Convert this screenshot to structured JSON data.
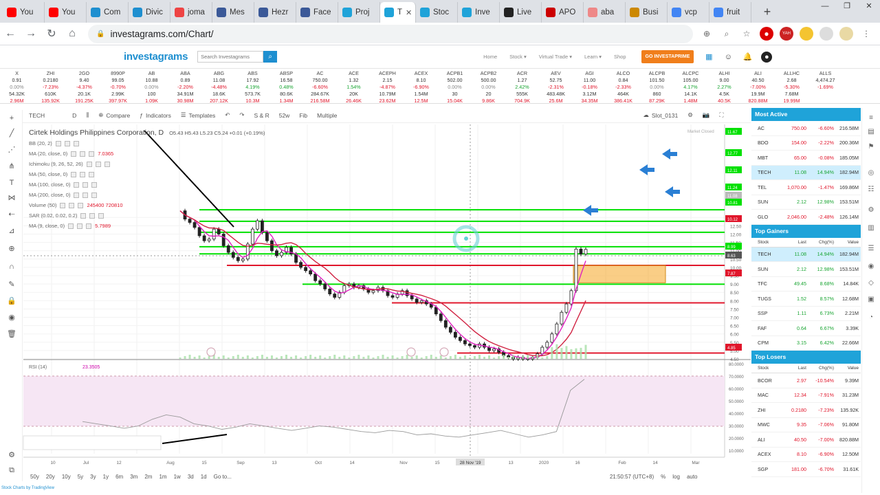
{
  "tabs": [
    {
      "label": "You",
      "fav": "#ff0000"
    },
    {
      "label": "You",
      "fav": "#ff0000"
    },
    {
      "label": "Com",
      "fav": "#1e8fd0"
    },
    {
      "label": "Divic",
      "fav": "#1e8fd0"
    },
    {
      "label": "joma",
      "fav": "#e44"
    },
    {
      "label": "Mes",
      "fav": "#3b5998"
    },
    {
      "label": "Hezr",
      "fav": "#3b5998"
    },
    {
      "label": "Face",
      "fav": "#3b5998"
    },
    {
      "label": "Proj",
      "fav": "#1fa3d9"
    },
    {
      "label": "T",
      "fav": "#1fa3d9",
      "active": true
    },
    {
      "label": "Stoc",
      "fav": "#1fa3d9"
    },
    {
      "label": "Inve",
      "fav": "#1fa3d9"
    },
    {
      "label": "Live",
      "fav": "#222"
    },
    {
      "label": "APO",
      "fav": "#c00"
    },
    {
      "label": "aba",
      "fav": "#e88"
    },
    {
      "label": "Busi",
      "fav": "#c80"
    },
    {
      "label": "vcp",
      "fav": "#4285f4"
    },
    {
      "label": "fruit",
      "fav": "#4285f4"
    }
  ],
  "address": {
    "url": "investagrams.com/Chart/"
  },
  "site": {
    "logo": "investagrams",
    "search_placeholder": "Search Investagrams",
    "nav": [
      "Home",
      "Stock ▾",
      "Virtual Trade ▾",
      "Learn ▾",
      "Shop"
    ],
    "go_button": "GO INVESTAPRIME"
  },
  "ticker": [
    {
      "s": "X",
      "l": "0.91",
      "c": "0.00%",
      "v": "2.96M",
      "d": "fl"
    },
    {
      "s": "ZHI",
      "l": "0.2180",
      "c": "-7.23%",
      "v": "135.92K",
      "d": "dn"
    },
    {
      "s": "2GO",
      "l": "9.40",
      "c": "-4.37%",
      "v": "191.25K",
      "d": "dn"
    },
    {
      "s": "8990P",
      "l": "99.05",
      "c": "-0.70%",
      "v": "397.97K",
      "d": "dn"
    },
    {
      "s": "AB",
      "l": "10.88",
      "c": "0.00%",
      "v": "1.09K",
      "d": "fl"
    },
    {
      "s": "ABA",
      "l": "0.89",
      "c": "-2.20%",
      "v": "30.98M",
      "d": "dn"
    },
    {
      "s": "ABG",
      "l": "11.08",
      "c": "-4.48%",
      "v": "207.12K",
      "d": "dn"
    },
    {
      "s": "ABS",
      "l": "17.92",
      "c": "4.19%",
      "v": "10.3M",
      "d": "up"
    },
    {
      "s": "ABSP",
      "l": "16.58",
      "c": "0.48%",
      "v": "1.34M",
      "d": "up"
    },
    {
      "s": "AC",
      "l": "750.00",
      "c": "-6.60%",
      "v": "216.58M",
      "d": "dn"
    },
    {
      "s": "ACE",
      "l": "1.32",
      "c": "1.54%",
      "v": "26.46K",
      "d": "up"
    },
    {
      "s": "ACEPH",
      "l": "2.15",
      "c": "-4.87%",
      "v": "23.62M",
      "d": "dn"
    },
    {
      "s": "ACEX",
      "l": "8.10",
      "c": "-6.90%",
      "v": "12.5M",
      "d": "dn"
    },
    {
      "s": "ACPB1",
      "l": "502.00",
      "c": "0.00%",
      "v": "15.04K",
      "d": "fl"
    },
    {
      "s": "ACPB2",
      "l": "500.00",
      "c": "0.00%",
      "v": "9.86K",
      "d": "fl"
    },
    {
      "s": "ACR",
      "l": "1.27",
      "c": "2.42%",
      "v": "704.9K",
      "d": "up"
    },
    {
      "s": "AEV",
      "l": "52.75",
      "c": "-2.31%",
      "v": "25.6M",
      "d": "dn"
    },
    {
      "s": "AGI",
      "l": "11.00",
      "c": "-0.18%",
      "v": "34.35M",
      "d": "dn"
    },
    {
      "s": "ALCO",
      "l": "0.84",
      "c": "-2.33%",
      "v": "386.41K",
      "d": "dn"
    },
    {
      "s": "ALCPB",
      "l": "101.50",
      "c": "0.00%",
      "v": "87.29K",
      "d": "fl"
    },
    {
      "s": "ALCPC",
      "l": "105.00",
      "c": "4.17%",
      "v": "1.48M",
      "d": "up"
    },
    {
      "s": "ALHI",
      "l": "9.00",
      "c": "2.27%",
      "v": "40.5K",
      "d": "up"
    },
    {
      "s": "ALI",
      "l": "40.50",
      "c": "-7.00%",
      "v": "820.88M",
      "d": "dn"
    },
    {
      "s": "ALLHC",
      "l": "2.68",
      "c": "-5.30%",
      "v": "19.99M",
      "d": "dn"
    },
    {
      "s": "ALLS",
      "l": "4,474.27",
      "c": "-1.69%",
      "v": "",
      "d": "dn"
    }
  ],
  "ticker_row3": [
    "54.32K",
    "610K",
    "20.1K",
    "2.99K",
    "100",
    "34.91M",
    "18.6K",
    "573.7K",
    "80.6K",
    "284.67K",
    "20K",
    "10.79M",
    "1.54M",
    "30",
    "20",
    "555K",
    "483.48K",
    "3.12M",
    "464K",
    "860",
    "14.1K",
    "4.5K",
    "19.9M",
    "7.68M",
    ""
  ],
  "toolbar": {
    "symbol": "TECH",
    "interval": "D",
    "compare": "Compare",
    "indicators": "Indicators",
    "templates": "Templates",
    "sr": "S & R",
    "w52": "52w",
    "fib": "Fib",
    "multiple": "Multiple",
    "slot": "Slot_0131"
  },
  "legend": {
    "title": "Cirtek Holdings Philippines Corporation, D",
    "ohlc": "O5.43  H5.43  L5.23  C5.24  +0.01 (+0.19%)",
    "rows": [
      {
        "label": "BB (20, 2)",
        "value": ""
      },
      {
        "label": "MA (20, close, 0)",
        "value": "7.0365"
      },
      {
        "label": "Ichimoku (9, 26, 52, 26)",
        "value": ""
      },
      {
        "label": "MA (50, close, 0)",
        "value": ""
      },
      {
        "label": "MA (100, close, 0)",
        "value": ""
      },
      {
        "label": "MA (200, close, 0)",
        "value": ""
      },
      {
        "label": "Volume (50)",
        "value": "245400  720810"
      },
      {
        "label": "SAR (0.02, 0.02, 0.2)",
        "value": ""
      },
      {
        "label": "MA (9, close, 0)",
        "value": "5.7989"
      }
    ],
    "rsi": "RSI (14)",
    "rsi_value": "23.3505"
  },
  "chart_data": {
    "type": "candlestick",
    "price_ticks": [
      "13.00",
      "12.50",
      "12.00",
      "11.50",
      "11.00",
      "10.50",
      "10.00",
      "9.50",
      "9.00",
      "8.50",
      "8.00",
      "7.50",
      "7.00",
      "6.50",
      "6.00",
      "5.50",
      "5.00",
      "4.50"
    ],
    "price_labels": [
      "11.67",
      "12.77",
      "12.11",
      "11.24",
      "11.08",
      "10.81",
      "10.12",
      "8.99",
      "8.63",
      "7.87",
      "4.85"
    ],
    "rsi_ticks": [
      "80.0000",
      "70.0000",
      "60.0000",
      "50.0000",
      "40.0000",
      "30.0000",
      "20.0000",
      "10.0000"
    ],
    "x_ticks": [
      "10",
      "Jul",
      "12",
      "Aug",
      "15",
      "Sep",
      "13",
      "Oct",
      "14",
      "Nov",
      "15",
      "Dec",
      "13",
      "2020",
      "16",
      "Feb",
      "14",
      "Mar"
    ],
    "crosshair_date": "28 Nov '19",
    "market_closed": "Market Closed"
  },
  "bottom": {
    "ranges": [
      "50y",
      "20y",
      "10y",
      "5y",
      "3y",
      "1y",
      "6m",
      "3m",
      "2m",
      "1m",
      "1w",
      "3d",
      "1d"
    ],
    "goto": "Go to...",
    "time": "21:50:57 (UTC+8)",
    "pct": "%",
    "log": "log",
    "auto": "auto",
    "credit": "Stock Charts by TradingView"
  },
  "panel": {
    "most_active_title": "Most Active",
    "most_active": [
      {
        "s": "AC",
        "l": "750.00",
        "c": "-6.60%",
        "v": "216.58M"
      },
      {
        "s": "BDO",
        "l": "154.00",
        "c": "-2.22%",
        "v": "200.36M"
      },
      {
        "s": "MBT",
        "l": "65.00",
        "c": "-0.08%",
        "v": "185.05M"
      },
      {
        "s": "TECH",
        "l": "11.08",
        "c": "14.94%",
        "v": "182.94M",
        "sel": true
      },
      {
        "s": "TEL",
        "l": "1,070.00",
        "c": "-1.47%",
        "v": "169.86M"
      },
      {
        "s": "SUN",
        "l": "2.12",
        "c": "12.98%",
        "v": "153.51M"
      },
      {
        "s": "GLO",
        "l": "2,046.00",
        "c": "-2.48%",
        "v": "126.14M"
      }
    ],
    "gainers_title": "Top Gainers",
    "losers_title": "Top Losers",
    "columns": [
      "Stock",
      "Last",
      "Chg(%)",
      "Value"
    ],
    "gainers": [
      {
        "s": "TECH",
        "l": "11.08",
        "c": "14.94%",
        "v": "182.94M",
        "sel": true
      },
      {
        "s": "SUN",
        "l": "2.12",
        "c": "12.98%",
        "v": "153.51M"
      },
      {
        "s": "TFC",
        "l": "49.45",
        "c": "8.68%",
        "v": "14.84K"
      },
      {
        "s": "TUGS",
        "l": "1.52",
        "c": "8.57%",
        "v": "12.68M"
      },
      {
        "s": "SSP",
        "l": "1.11",
        "c": "6.73%",
        "v": "2.21M"
      },
      {
        "s": "FAF",
        "l": "0.64",
        "c": "6.67%",
        "v": "3.39K"
      },
      {
        "s": "CPM",
        "l": "3.15",
        "c": "6.42%",
        "v": "22.66M"
      }
    ],
    "losers": [
      {
        "s": "BCOR",
        "l": "2.97",
        "c": "-10.54%",
        "v": "9.39M"
      },
      {
        "s": "MAC",
        "l": "12.34",
        "c": "-7.91%",
        "v": "31.23M"
      },
      {
        "s": "ZHI",
        "l": "0.2180",
        "c": "-7.23%",
        "v": "135.92K"
      },
      {
        "s": "MWC",
        "l": "9.35",
        "c": "-7.06%",
        "v": "91.80M"
      },
      {
        "s": "ALI",
        "l": "40.50",
        "c": "-7.00%",
        "v": "820.88M"
      },
      {
        "s": "ACEX",
        "l": "8.10",
        "c": "-6.90%",
        "v": "12.50M"
      },
      {
        "s": "SGP",
        "l": "181.00",
        "c": "-6.70%",
        "v": "31.61K"
      }
    ]
  },
  "colors": {
    "accent": "#1fa3d9",
    "up": "#19a532",
    "down": "#e0162b",
    "support_line": "#00e000",
    "resist_line": "#e0162b",
    "zone": "#f5a623"
  }
}
